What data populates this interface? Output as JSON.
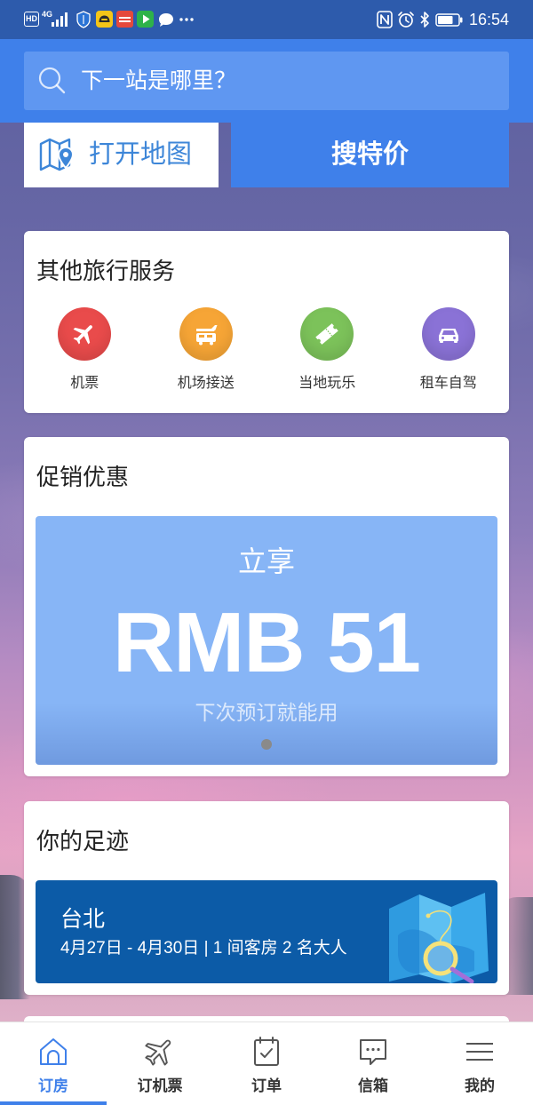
{
  "status_bar": {
    "hd_label": "HD",
    "network_label": "4G",
    "signal_level": 4,
    "signal_max": 4,
    "notification_icons": [
      "shield-icon",
      "yellow-app-icon",
      "red-app-icon",
      "green-play-app-icon",
      "chat-bubble-icon",
      "more-notifications-icon"
    ],
    "system_icons": [
      "nfc-icon",
      "alarm-icon",
      "bluetooth-icon",
      "battery-icon"
    ],
    "battery_level": 0.75,
    "time": "16:54"
  },
  "search": {
    "icon": "search-icon",
    "placeholder": "下一站是哪里？"
  },
  "actions": {
    "map": {
      "icon": "map-pin-icon",
      "label": "打开地图"
    },
    "deals": {
      "label": "搜特价"
    }
  },
  "services": {
    "title": "其他旅行服务",
    "items": [
      {
        "label": "机票",
        "icon": "plane-icon",
        "color": "#e94b4b"
      },
      {
        "label": "机场接送",
        "icon": "airport-shuttle-icon",
        "color": "#f6a536"
      },
      {
        "label": "当地玩乐",
        "icon": "ticket-icon",
        "color": "#7cc25a"
      },
      {
        "label": "租车自驾",
        "icon": "car-icon",
        "color": "#8a72d6"
      }
    ]
  },
  "promo": {
    "title": "促销优惠",
    "banner": {
      "kicker": "立享",
      "amount": "RMB 51",
      "note": "下次预订就能用"
    },
    "carousel_dots": 1,
    "carousel_active": 0
  },
  "footprint": {
    "title": "你的足迹",
    "recent": {
      "city": "台北",
      "details": "4月27日 - 4月30日 | 1 间客房 2 名大人",
      "illustration": "map-magnifier-illustration"
    }
  },
  "bottom_nav": {
    "active": 0,
    "items": [
      {
        "label": "订房",
        "icon": "hotel-house-icon"
      },
      {
        "label": "订机票",
        "icon": "plane-outline-icon"
      },
      {
        "label": "订单",
        "icon": "clipboard-check-icon"
      },
      {
        "label": "信箱",
        "icon": "message-bubble-icon"
      },
      {
        "label": "我的",
        "icon": "menu-icon"
      }
    ]
  },
  "colors": {
    "accent": "#3f80ea",
    "status_bar": "#2d5bac",
    "search_field": "#5f97f1",
    "map_button_text": "#3d86d8",
    "promo_banner": "#87b5f6",
    "footprint_banner": "#0c5ba7",
    "carousel_dot": "#8a8a8a"
  }
}
